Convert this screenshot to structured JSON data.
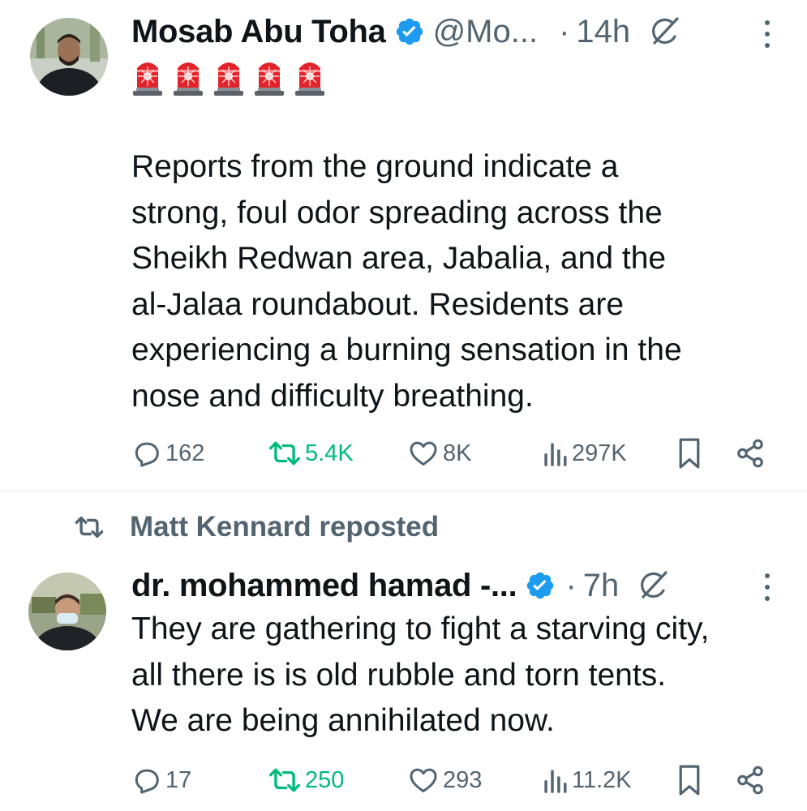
{
  "tweets": [
    {
      "author_name": "Mosab Abu Toha",
      "handle": "@Mo...",
      "separator": "·",
      "time": "14h",
      "emoji_row": [
        "police-car-light",
        "police-car-light",
        "police-car-light",
        "police-car-light",
        "police-car-light"
      ],
      "text_lines": [
        "Reports from the ground indicate a",
        "strong, foul odor spreading across the",
        "Sheikh Redwan area, Jabalia, and the",
        "al-Jalaa roundabout. Residents are",
        "experiencing a burning sensation in the",
        "nose and difficulty breathing."
      ],
      "replies": "162",
      "reposts": "5.4K",
      "likes": "8K",
      "views": "297K"
    },
    {
      "repost_label": "Matt Kennard reposted",
      "author_name": "dr. mohammed hamad -...",
      "separator": "·",
      "time": "7h",
      "text_lines": [
        "They are gathering to fight a starving city,",
        "all there is is old rubble and torn tents.",
        "We are being annihilated now."
      ],
      "replies": "17",
      "reposts": "250",
      "likes": "293",
      "views": "11.2K"
    }
  ],
  "colors": {
    "text": "#0f1419",
    "secondary": "#536471",
    "verified": "#1d9bf0",
    "repost_green": "#00ba7c"
  }
}
